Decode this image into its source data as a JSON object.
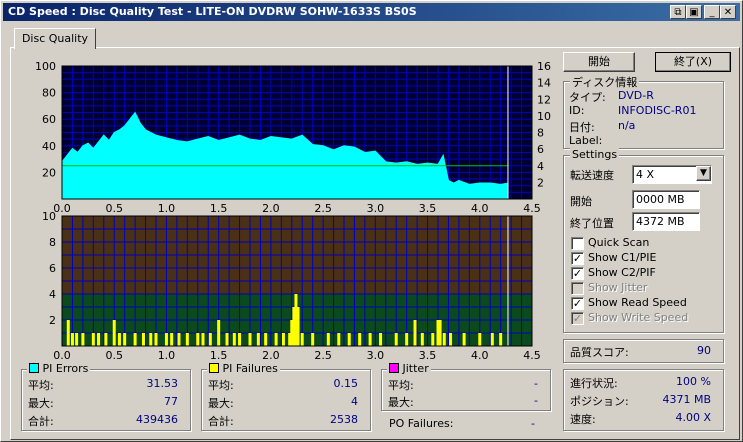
{
  "window": {
    "title": "CD Speed : Disc Quality Test - LITE-ON DVDRW SOHW-1633S BS0S"
  },
  "tab": {
    "label": "Disc Quality"
  },
  "buttons": {
    "start": "開始",
    "stop": "終了(X)"
  },
  "disc_info": {
    "title": "ディスク情報",
    "type_label": "タイプ:",
    "type_value": "DVD-R",
    "id_label": "ID:",
    "id_value": "INFODISC-R01",
    "date_label": "日付:",
    "date_value": "n/a",
    "label_label": "Label:",
    "label_value": ""
  },
  "settings": {
    "title": "Settings",
    "speed_label": "転送速度",
    "speed_value": "4 X",
    "start_label": "開始",
    "start_value": "0000 MB",
    "end_label": "終了位置",
    "end_value": "4372 MB",
    "checks": [
      {
        "label": "Quick Scan",
        "checked": false,
        "disabled": false
      },
      {
        "label": "Show C1/PIE",
        "checked": true,
        "disabled": false
      },
      {
        "label": "Show C2/PIF",
        "checked": true,
        "disabled": false
      },
      {
        "label": "Show Jitter",
        "checked": false,
        "disabled": true
      },
      {
        "label": "Show Read Speed",
        "checked": true,
        "disabled": false
      },
      {
        "label": "Show Write Speed",
        "checked": true,
        "disabled": true
      }
    ]
  },
  "quality": {
    "label": "品質スコア:",
    "value": "90"
  },
  "progress": {
    "progress_label": "進行状況:",
    "progress_value": "100 %",
    "position_label": "ポジション:",
    "position_value": "4371 MB",
    "speed_label": "速度:",
    "speed_value": "4.00 X"
  },
  "pi_errors": {
    "title": "PI Errors",
    "avg_label": "平均:",
    "avg": "31.53",
    "max_label": "最大:",
    "max": "77",
    "total_label": "合計:",
    "total": "439436",
    "color": "#00ffff"
  },
  "pi_failures": {
    "title": "PI Failures",
    "avg_label": "平均:",
    "avg": "0.15",
    "max_label": "最大:",
    "max": "4",
    "total_label": "合計:",
    "total": "2538",
    "color": "#ffff00"
  },
  "jitter": {
    "title": "Jitter",
    "avg_label": "平均:",
    "avg": "-",
    "max_label": "最大:",
    "max": "-",
    "color": "#ff00ff"
  },
  "po_failures": {
    "label": "PO Failures:",
    "value": "-"
  },
  "chart_data": [
    {
      "type": "area",
      "series": [
        {
          "name": "PI Errors",
          "color": "#00ffff",
          "x": [
            0.0,
            0.05,
            0.1,
            0.15,
            0.2,
            0.25,
            0.3,
            0.35,
            0.4,
            0.45,
            0.5,
            0.55,
            0.6,
            0.65,
            0.7,
            0.75,
            0.8,
            0.85,
            0.9,
            0.95,
            1.0,
            1.1,
            1.2,
            1.3,
            1.4,
            1.5,
            1.6,
            1.7,
            1.8,
            1.9,
            2.0,
            2.1,
            2.2,
            2.3,
            2.4,
            2.5,
            2.6,
            2.7,
            2.8,
            2.9,
            3.0,
            3.1,
            3.2,
            3.3,
            3.4,
            3.5,
            3.6,
            3.65,
            3.7,
            3.75,
            3.8,
            3.9,
            4.0,
            4.1,
            4.2,
            4.27
          ],
          "y": [
            28,
            33,
            38,
            35,
            40,
            42,
            38,
            43,
            48,
            44,
            50,
            52,
            55,
            60,
            65,
            57,
            52,
            50,
            48,
            47,
            46,
            44,
            43,
            45,
            47,
            44,
            46,
            48,
            45,
            44,
            47,
            46,
            45,
            48,
            41,
            40,
            37,
            40,
            39,
            35,
            36,
            28,
            27,
            28,
            26,
            27,
            26,
            33,
            14,
            12,
            14,
            11,
            12,
            12,
            11,
            12
          ]
        },
        {
          "name": "Read Speed",
          "color": "#00c000",
          "x": [
            0.0,
            1.0,
            2.0,
            3.0,
            4.0,
            4.27
          ],
          "y": [
            4.0,
            4.0,
            4.0,
            4.0,
            4.0,
            4.0
          ]
        }
      ],
      "xlim": [
        0,
        4.5
      ],
      "ylim": [
        0,
        100
      ],
      "y2lim": [
        0,
        16
      ],
      "xticks": [
        "0.0",
        "0.5",
        "1.0",
        "1.5",
        "2.0",
        "2.5",
        "3.0",
        "3.5",
        "4.0",
        "4.5"
      ],
      "yticks": [
        "20",
        "40",
        "60",
        "80",
        "100"
      ],
      "y2ticks": [
        "2",
        "4",
        "6",
        "8",
        "10",
        "12",
        "14",
        "16"
      ]
    },
    {
      "type": "bar",
      "series": [
        {
          "name": "PI Failures",
          "color": "#ffff00",
          "x": [
            0.06,
            0.1,
            0.14,
            0.2,
            0.3,
            0.35,
            0.42,
            0.5,
            0.55,
            0.6,
            0.7,
            0.78,
            0.85,
            0.9,
            1.0,
            1.05,
            1.12,
            1.2,
            1.3,
            1.35,
            1.42,
            1.5,
            1.58,
            1.65,
            1.7,
            1.8,
            1.88,
            1.95,
            2.05,
            2.12,
            2.18,
            2.2,
            2.22,
            2.24,
            2.26,
            2.3,
            2.4,
            2.55,
            2.65,
            2.75,
            2.85,
            2.95,
            3.05,
            3.2,
            3.3,
            3.38,
            3.45,
            3.55,
            3.6,
            3.62,
            3.66,
            3.72,
            3.85,
            4.0,
            4.12,
            4.2
          ],
          "y": [
            2,
            1,
            1,
            1,
            1,
            1,
            1,
            2,
            1,
            1,
            1,
            1,
            1,
            1,
            1,
            1,
            1,
            1,
            1,
            1,
            1,
            2,
            1,
            1,
            1,
            1,
            1,
            1,
            1,
            1,
            1,
            2,
            3,
            4,
            3,
            1,
            1,
            1,
            1,
            1,
            1,
            1,
            1,
            1,
            1,
            2,
            1,
            1,
            2,
            2,
            1,
            1,
            1,
            1,
            1,
            1
          ]
        }
      ],
      "xlim": [
        0,
        4.5
      ],
      "ylim": [
        0,
        10
      ],
      "xticks": [
        "0.0",
        "0.5",
        "1.0",
        "1.5",
        "2.0",
        "2.5",
        "3.0",
        "3.5",
        "4.0",
        "4.5"
      ],
      "yticks": [
        "2",
        "4",
        "6",
        "8",
        "10"
      ]
    }
  ]
}
